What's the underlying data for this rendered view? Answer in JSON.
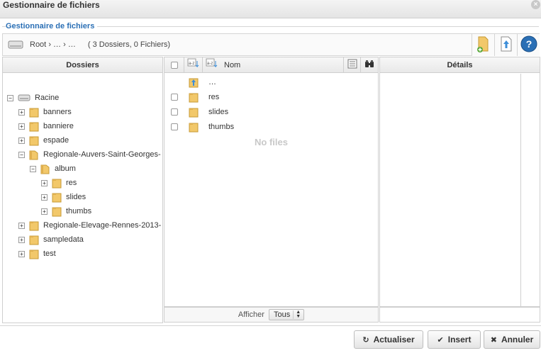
{
  "dialog": {
    "title": "Gestionnaire de fichiers",
    "close_glyph": "×"
  },
  "fieldset": {
    "legend": "Gestionnaire de fichiers"
  },
  "toolbar": {
    "breadcrumb": [
      "Root",
      "…",
      "…"
    ],
    "separator": "›",
    "counts": "( 3 Dossiers, 0 Fichiers)",
    "buttons": [
      "new-folder-icon",
      "upload-icon",
      "help-icon"
    ]
  },
  "folders_panel": {
    "header": "Dossiers",
    "tree": [
      {
        "label": "Racine",
        "depth": 0,
        "toggle": "−",
        "icon": "drive-icon"
      },
      {
        "label": "banners",
        "depth": 1,
        "toggle": "+",
        "icon": "folder-icon"
      },
      {
        "label": "banniere",
        "depth": 1,
        "toggle": "+",
        "icon": "folder-icon"
      },
      {
        "label": "espade",
        "depth": 1,
        "toggle": "+",
        "icon": "folder-icon"
      },
      {
        "label": "Regionale-Auvers-Saint-Georges-",
        "depth": 1,
        "toggle": "−",
        "icon": "folder-open-icon"
      },
      {
        "label": "album",
        "depth": 2,
        "toggle": "−",
        "icon": "folder-open-icon"
      },
      {
        "label": "res",
        "depth": 3,
        "toggle": "+",
        "icon": "folder-icon"
      },
      {
        "label": "slides",
        "depth": 3,
        "toggle": "+",
        "icon": "folder-icon"
      },
      {
        "label": "thumbs",
        "depth": 3,
        "toggle": "+",
        "icon": "folder-icon"
      },
      {
        "label": "Regionale-Elevage-Rennes-2013-",
        "depth": 1,
        "toggle": "+",
        "icon": "folder-icon"
      },
      {
        "label": "sampledata",
        "depth": 1,
        "toggle": "+",
        "icon": "folder-icon"
      },
      {
        "label": "test",
        "depth": 1,
        "toggle": "+",
        "icon": "folder-icon"
      }
    ]
  },
  "files_panel": {
    "column_name": "Nom",
    "rows": [
      {
        "label": "…",
        "icon": "folder-up-icon",
        "checkbox": false
      },
      {
        "label": "res",
        "icon": "folder-icon",
        "checkbox": true
      },
      {
        "label": "slides",
        "icon": "folder-icon",
        "checkbox": true
      },
      {
        "label": "thumbs",
        "icon": "folder-icon",
        "checkbox": true
      }
    ],
    "empty_text": "No files",
    "show_label": "Afficher",
    "show_value": "Tous"
  },
  "details_panel": {
    "header": "Détails"
  },
  "actions": {
    "refresh": "Actualiser",
    "insert": "Insert",
    "cancel": "Annuler"
  },
  "colors": {
    "legend": "#2a6fb5",
    "folder": "#f2c86a",
    "help": "#2a6fb5"
  }
}
